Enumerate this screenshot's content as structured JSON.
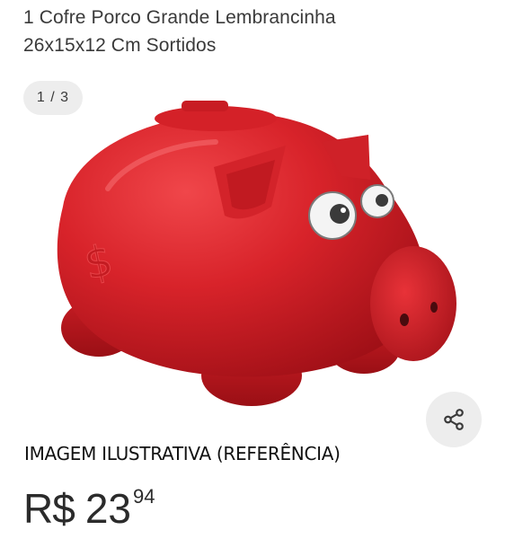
{
  "product": {
    "title_line1": "1 Cofre Porco Grande Lembrancinha",
    "title_line2": "26x15x12 Cm Sortidos"
  },
  "gallery": {
    "counter": "1 / 3",
    "image_description": "red piggy bank",
    "share_icon": "share-icon"
  },
  "caption": "IMAGEM ILUSTRATIVA (REFERÊNCIA)",
  "price": {
    "currency": "R$",
    "integer": "23",
    "cents": "94"
  },
  "colors": {
    "pig_red": "#d8232a",
    "counter_bg": "#ededed",
    "share_bg": "#ededed"
  }
}
